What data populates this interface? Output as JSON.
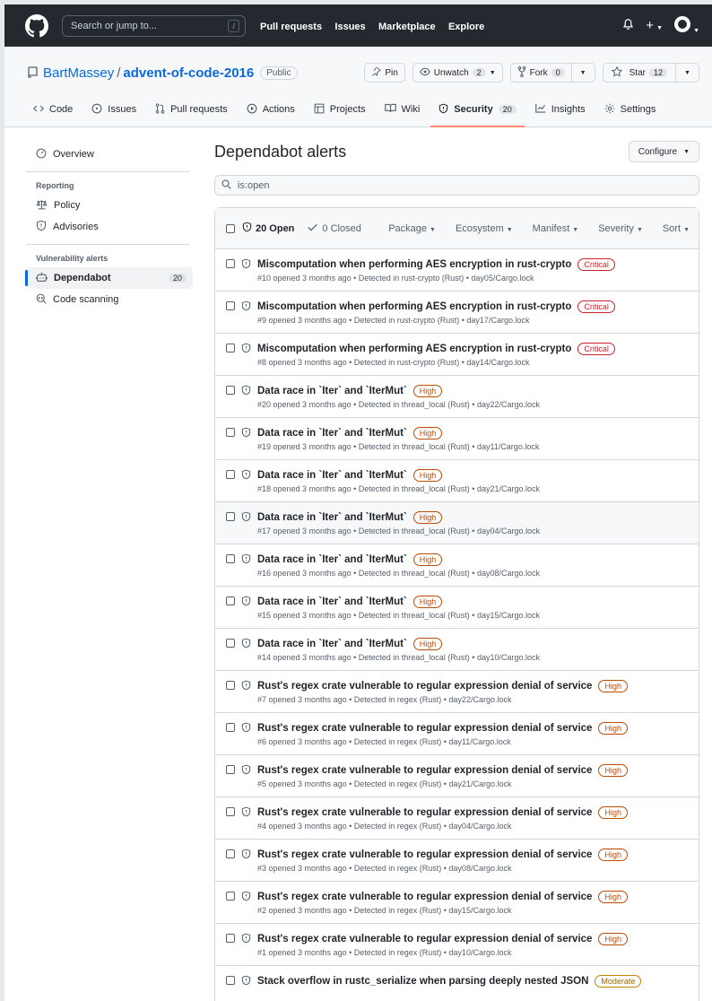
{
  "header": {
    "search_placeholder": "Search or jump to...",
    "slash_hint": "/",
    "nav": [
      "Pull requests",
      "Issues",
      "Marketplace",
      "Explore"
    ],
    "plus": "+"
  },
  "repo": {
    "owner": "BartMassey",
    "separator": "/",
    "name": "advent-of-code-2016",
    "visibility": "Public",
    "pin_label": "Pin",
    "watch_label": "Unwatch",
    "watch_count": "2",
    "fork_label": "Fork",
    "fork_count": "0",
    "star_label": "Star",
    "star_count": "12"
  },
  "tabs": [
    {
      "label": "Code",
      "icon": "code-icon"
    },
    {
      "label": "Issues",
      "icon": "issue-icon"
    },
    {
      "label": "Pull requests",
      "icon": "pull-request-icon"
    },
    {
      "label": "Actions",
      "icon": "play-icon"
    },
    {
      "label": "Projects",
      "icon": "table-icon"
    },
    {
      "label": "Wiki",
      "icon": "book-icon"
    },
    {
      "label": "Security",
      "icon": "shield-icon",
      "count": "20",
      "selected": true
    },
    {
      "label": "Insights",
      "icon": "graph-icon"
    },
    {
      "label": "Settings",
      "icon": "gear-icon"
    }
  ],
  "sidebar": {
    "overview": "Overview",
    "reporting_heading": "Reporting",
    "policy": "Policy",
    "advisories": "Advisories",
    "vuln_heading": "Vulnerability alerts",
    "dependabot": "Dependabot",
    "dependabot_count": "20",
    "code_scanning": "Code scanning"
  },
  "main": {
    "title": "Dependabot alerts",
    "configure": "Configure",
    "filter_value": "is:open",
    "open_label": "20 Open",
    "closed_label": "0 Closed",
    "filters": [
      "Package",
      "Ecosystem",
      "Manifest",
      "Severity",
      "Sort"
    ]
  },
  "alerts": [
    {
      "title": "Miscomputation when performing AES encryption in rust-crypto",
      "severity": "Critical",
      "meta": "#10 opened 3 months ago • Detected in rust-crypto (Rust) • day05/Cargo.lock"
    },
    {
      "title": "Miscomputation when performing AES encryption in rust-crypto",
      "severity": "Critical",
      "meta": "#9 opened 3 months ago • Detected in rust-crypto (Rust) • day17/Cargo.lock"
    },
    {
      "title": "Miscomputation when performing AES encryption in rust-crypto",
      "severity": "Critical",
      "meta": "#8 opened 3 months ago • Detected in rust-crypto (Rust) • day14/Cargo.lock"
    },
    {
      "title": "Data race in `Iter` and `IterMut`",
      "severity": "High",
      "meta": "#20 opened 3 months ago • Detected in thread_local (Rust) • day22/Cargo.lock"
    },
    {
      "title": "Data race in `Iter` and `IterMut`",
      "severity": "High",
      "meta": "#19 opened 3 months ago • Detected in thread_local (Rust) • day11/Cargo.lock"
    },
    {
      "title": "Data race in `Iter` and `IterMut`",
      "severity": "High",
      "meta": "#18 opened 3 months ago • Detected in thread_local (Rust) • day21/Cargo.lock"
    },
    {
      "title": "Data race in `Iter` and `IterMut`",
      "severity": "High",
      "meta": "#17 opened 3 months ago • Detected in thread_local (Rust) • day04/Cargo.lock",
      "hover": true
    },
    {
      "title": "Data race in `Iter` and `IterMut`",
      "severity": "High",
      "meta": "#16 opened 3 months ago • Detected in thread_local (Rust) • day08/Cargo.lock"
    },
    {
      "title": "Data race in `Iter` and `IterMut`",
      "severity": "High",
      "meta": "#15 opened 3 months ago • Detected in thread_local (Rust) • day15/Cargo.lock"
    },
    {
      "title": "Data race in `Iter` and `IterMut`",
      "severity": "High",
      "meta": "#14 opened 3 months ago • Detected in thread_local (Rust) • day10/Cargo.lock"
    },
    {
      "title": "Rust's regex crate vulnerable to regular expression denial of service",
      "severity": "High",
      "meta": "#7 opened 3 months ago • Detected in regex (Rust) • day22/Cargo.lock"
    },
    {
      "title": "Rust's regex crate vulnerable to regular expression denial of service",
      "severity": "High",
      "meta": "#6 opened 3 months ago • Detected in regex (Rust) • day11/Cargo.lock"
    },
    {
      "title": "Rust's regex crate vulnerable to regular expression denial of service",
      "severity": "High",
      "meta": "#5 opened 3 months ago • Detected in regex (Rust) • day21/Cargo.lock"
    },
    {
      "title": "Rust's regex crate vulnerable to regular expression denial of service",
      "severity": "High",
      "meta": "#4 opened 3 months ago • Detected in regex (Rust) • day04/Cargo.lock"
    },
    {
      "title": "Rust's regex crate vulnerable to regular expression denial of service",
      "severity": "High",
      "meta": "#3 opened 3 months ago • Detected in regex (Rust) • day08/Cargo.lock"
    },
    {
      "title": "Rust's regex crate vulnerable to regular expression denial of service",
      "severity": "High",
      "meta": "#2 opened 3 months ago • Detected in regex (Rust) • day15/Cargo.lock"
    },
    {
      "title": "Rust's regex crate vulnerable to regular expression denial of service",
      "severity": "High",
      "meta": "#1 opened 3 months ago • Detected in regex (Rust) • day10/Cargo.lock"
    },
    {
      "title": "Stack overflow in rustc_serialize when parsing deeply nested JSON",
      "severity": "Moderate",
      "meta": ""
    }
  ],
  "colors": {
    "accent": "#0969da",
    "header_bg": "#24292f",
    "tab_underline": "#fd8c73"
  }
}
